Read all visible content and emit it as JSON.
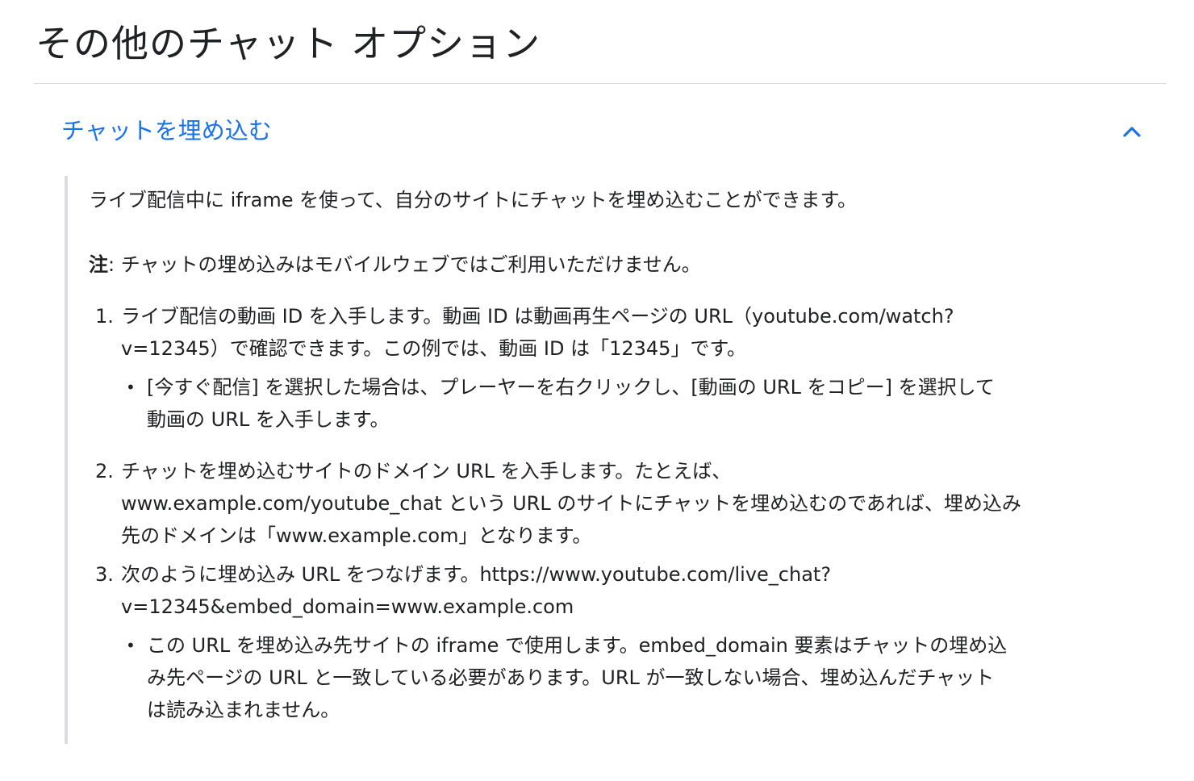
{
  "page": {
    "title": "その他のチャット オプション"
  },
  "accordion": {
    "title": "チャットを埋め込む",
    "expanded_icon": "chevron-up-icon",
    "accent_color": "#1a73e8"
  },
  "content": {
    "intro": "ライブ配信中に iframe を使って、自分のサイトにチャットを埋め込むことができます。",
    "note_label": "注",
    "note_text": ": チャットの埋め込みはモバイルウェブではご利用いただけません。",
    "steps": [
      {
        "number": "1.",
        "lines": [
          "ライブ配信の動画 ID を入手します。動画 ID は動画再生ページの URL（youtube.com/watch?",
          "v=12345）で確認できます。この例では、動画 ID は「12345」です。"
        ],
        "bullet_lines": [
          "[今すぐ配信] を選択した場合は、プレーヤーを右クリックし、[動画の URL をコピー] を選択して",
          "動画の URL を入手します。"
        ]
      },
      {
        "number": "2.",
        "lines": [
          "チャットを埋め込むサイトのドメイン URL を入手します。たとえば、",
          "www.example.com/youtube_chat という URL のサイトにチャットを埋め込むのであれば、埋め込み",
          "先のドメインは「www.example.com」となります。"
        ]
      },
      {
        "number": "3.",
        "lines": [
          "次のように埋め込み URL をつなげます。https://www.youtube.com/live_chat?",
          "v=12345&embed_domain=www.example.com"
        ],
        "bullet_lines": [
          "この URL を埋め込み先サイトの iframe で使用します。embed_domain 要素はチャットの埋め込",
          "み先ページの URL と一致している必要があります。URL が一致しない場合、埋め込んだチャット",
          "は読み込まれません。"
        ]
      }
    ]
  }
}
